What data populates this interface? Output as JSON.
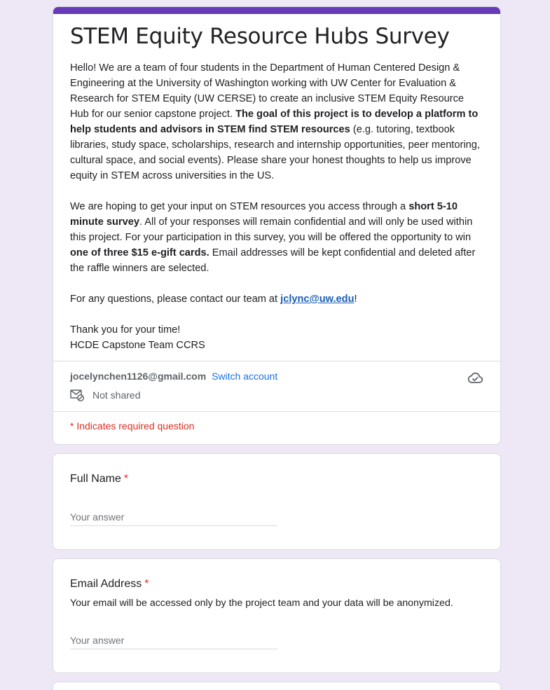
{
  "form": {
    "title": "STEM Equity Resource Hubs Survey",
    "accent_color": "#673ab7",
    "background_color": "#ede7f6",
    "description": {
      "p1_a": "Hello! We are a team of four students in the Department of Human Centered Design & Engineering at the University of Washington working with UW Center for Evaluation & Research for STEM Equity (UW CERSE) to create an inclusive STEM Equity Resource Hub for our senior capstone project. ",
      "p1_bold": "The goal of this project is to develop a platform to help students and advisors in STEM find STEM resources",
      "p1_b": " (e.g. tutoring, textbook libraries, study space, scholarships, research and internship opportunities, peer mentoring, cultural space, and social events). Please share your honest thoughts to help us improve equity in STEM across universities in the US.",
      "p2_a": "We are hoping to get your input on STEM resources you access through a ",
      "p2_bold1": "short 5-10 minute survey",
      "p2_b": ". All of your responses will remain confidential and will only be used within this project. For your participation in this survey, you will be offered the opportunity to win ",
      "p2_bold2": "one of three $15 e-gift cards.",
      "p2_c": " Email addresses will be kept confidential and deleted after the raffle winners are selected.",
      "p3_a": "For any questions, please contact our team at ",
      "p3_link": "jclync@uw.edu",
      "p3_b": "!",
      "p4_line1": "Thank you for your time!",
      "p4_line2": "HCDE Capstone Team CCRS"
    }
  },
  "account": {
    "email": "jocelynchen1126@gmail.com",
    "switch_label": "Switch account",
    "not_shared_label": "Not shared",
    "mail_icon": "mail-lock-icon",
    "cloud_icon": "cloud-done-icon"
  },
  "required_note": "* Indicates required question",
  "questions": [
    {
      "title": "Full Name",
      "required_mark": "*",
      "placeholder": "Your answer"
    },
    {
      "title": "Email Address",
      "required_mark": "*",
      "description": "Your email will be accessed only by the project team and your data will be anonymized.",
      "placeholder": "Your answer"
    }
  ]
}
